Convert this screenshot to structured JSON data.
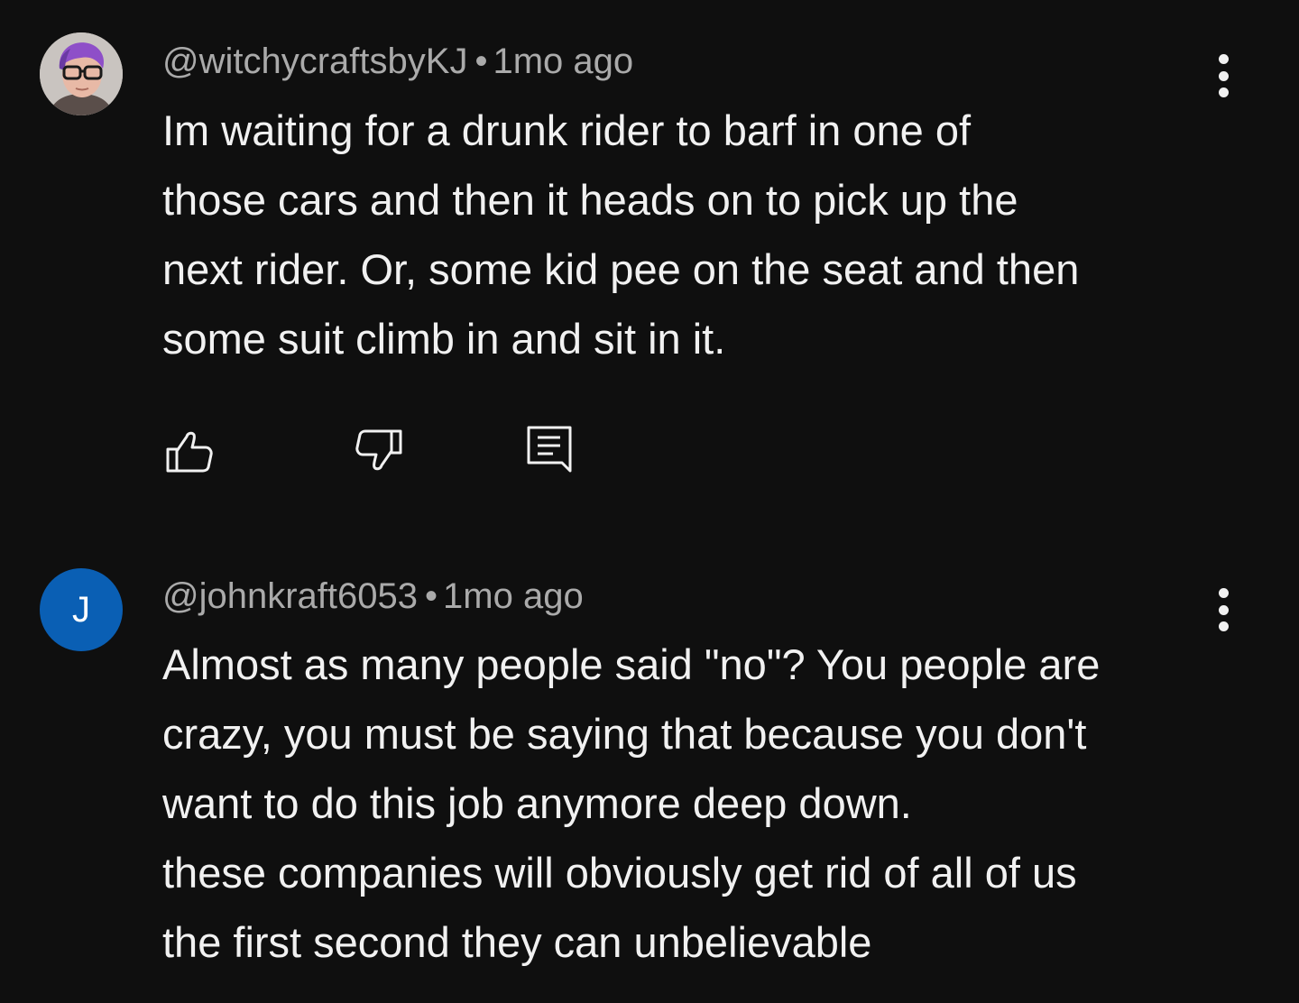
{
  "comments": [
    {
      "author": "@witchycraftsbyKJ",
      "separator": "•",
      "time": "1mo ago",
      "avatar": {
        "type": "photo",
        "icon": "profile-photo"
      },
      "lines": [
        "Im waiting for a drunk rider to barf in one of",
        "those cars and then it heads on to pick up the",
        "next rider. Or, some kid pee on the seat and then",
        "some suit climb in and sit in it."
      ],
      "actions": [
        "like-icon",
        "dislike-icon",
        "reply-icon"
      ]
    },
    {
      "author": "@johnkraft6053",
      "separator": "•",
      "time": "1mo ago",
      "avatar": {
        "type": "initial",
        "letter": "J",
        "color": "#0a5fb4"
      },
      "lines": [
        "Almost as many people said \"no\"? You people are",
        "crazy, you must be saying that because you don't",
        "want to do this job anymore deep down.",
        "these companies will obviously get rid of all of us",
        "the first second they can unbelievable"
      ]
    }
  ],
  "colors": {
    "background": "#0f0f0f",
    "text": "#f1f1f1",
    "meta": "#aaaaaa",
    "avatar_blue": "#0a5fb4"
  }
}
